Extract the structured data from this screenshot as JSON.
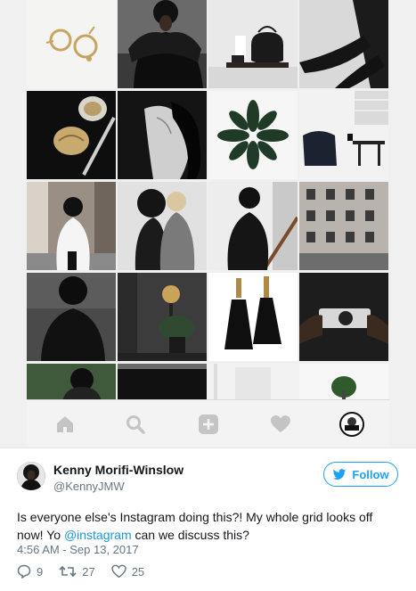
{
  "tweet": {
    "name": "Kenny Morifi-Winslow",
    "handle": "@KennyJMW",
    "follow_label": "Follow",
    "text_before": "Is everyone else's Instagram doing this?! My whole grid looks off now! Yo ",
    "mention": "@instagram",
    "text_after": " can we discuss this?",
    "timestamp": "4:56 AM - Sep 13, 2017",
    "replies": "9",
    "retweets": "27",
    "likes": "25"
  },
  "colors": {
    "accent": "#1da1f2",
    "text": "#14171a",
    "muted": "#657786"
  },
  "icons": {
    "tabs": [
      "home-icon",
      "search-icon",
      "add-post-icon",
      "heart-icon",
      "profile-avatar-icon"
    ],
    "tweet": [
      "reply-icon",
      "retweet-icon",
      "like-icon",
      "twitter-bird-icon"
    ]
  }
}
